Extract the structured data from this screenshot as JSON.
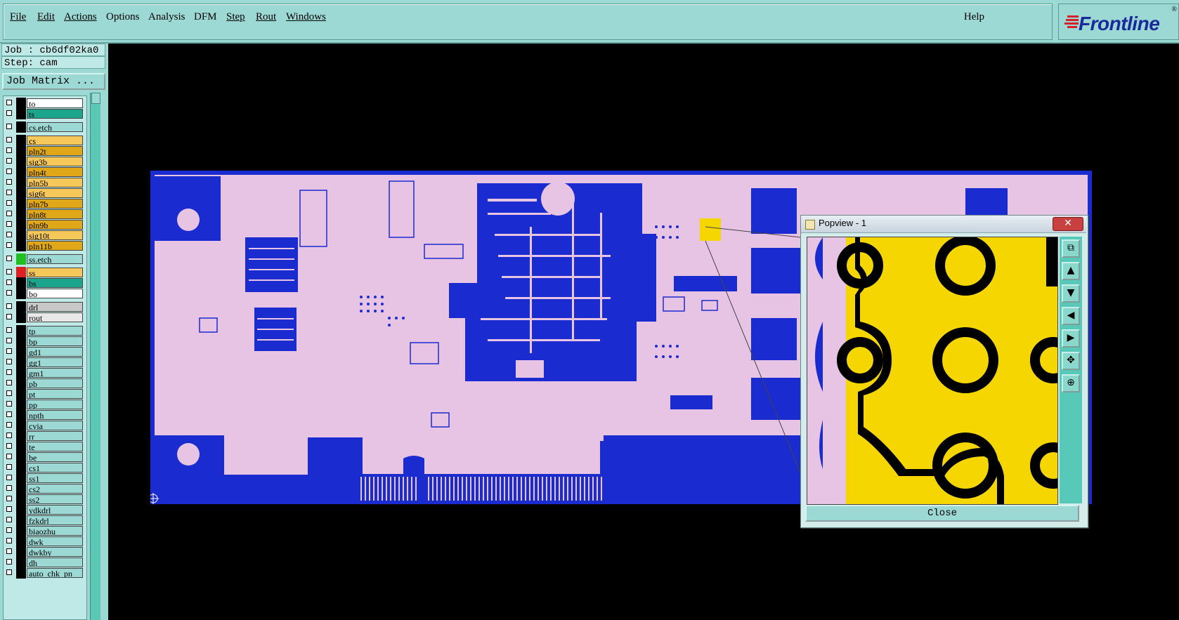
{
  "menu": {
    "items": [
      "File",
      "Edit",
      "Actions",
      "Options",
      "Analysis",
      "DFM",
      "Step",
      "Rout",
      "Windows"
    ],
    "help": "Help"
  },
  "logo": {
    "name": "Frontline",
    "mark": "®"
  },
  "job": {
    "job_line": "Job : cb6df02ka0",
    "step_line": "Step: cam",
    "matrix_button": "Job Matrix ..."
  },
  "layers": [
    {
      "name": "to",
      "color": "#ffffff"
    },
    {
      "name": "ts",
      "color": "#1aa58c"
    },
    {
      "name": "cs.etch",
      "color": "#9cd8d4"
    },
    {
      "name": "cs",
      "color": "#f6c85a"
    },
    {
      "name": "pln2t",
      "color": "#e0a818"
    },
    {
      "name": "sig3b",
      "color": "#f6c85a"
    },
    {
      "name": "pln4t",
      "color": "#e0a818"
    },
    {
      "name": "pln5b",
      "color": "#f6c85a"
    },
    {
      "name": "sig6t",
      "color": "#f6c85a"
    },
    {
      "name": "pln7b",
      "color": "#e0a818"
    },
    {
      "name": "pln8t",
      "color": "#e0a818"
    },
    {
      "name": "pln9b",
      "color": "#e0a818"
    },
    {
      "name": "sig10t",
      "color": "#f6c85a"
    },
    {
      "name": "pln11b",
      "color": "#e0a818"
    },
    {
      "name": "ss.etch",
      "color": "#9cd8d4"
    },
    {
      "name": "ss",
      "color": "#f6c85a"
    },
    {
      "name": "bs",
      "color": "#1aa58c"
    },
    {
      "name": "bo",
      "color": "#ffffff"
    },
    {
      "name": "drl",
      "color": "#c8c8c8"
    },
    {
      "name": "rout",
      "color": "#e8e8e8"
    },
    {
      "name": "tp",
      "color": "#9cd8d4"
    },
    {
      "name": "bp",
      "color": "#9cd8d4"
    },
    {
      "name": "gd1",
      "color": "#9cd8d4"
    },
    {
      "name": "gg1",
      "color": "#9cd8d4"
    },
    {
      "name": "gm1",
      "color": "#9cd8d4"
    },
    {
      "name": "pb",
      "color": "#9cd8d4"
    },
    {
      "name": "pt",
      "color": "#9cd8d4"
    },
    {
      "name": "pp",
      "color": "#9cd8d4"
    },
    {
      "name": "npth",
      "color": "#9cd8d4"
    },
    {
      "name": "cvia",
      "color": "#9cd8d4"
    },
    {
      "name": "rr",
      "color": "#9cd8d4"
    },
    {
      "name": "te",
      "color": "#9cd8d4"
    },
    {
      "name": "be",
      "color": "#9cd8d4"
    },
    {
      "name": "cs1",
      "color": "#9cd8d4"
    },
    {
      "name": "ss1",
      "color": "#9cd8d4"
    },
    {
      "name": "cs2",
      "color": "#9cd8d4"
    },
    {
      "name": "ss2",
      "color": "#9cd8d4"
    },
    {
      "name": "ydkdrl",
      "color": "#9cd8d4"
    },
    {
      "name": "fzkdrl",
      "color": "#9cd8d4"
    },
    {
      "name": "biaozhu",
      "color": "#9cd8d4"
    },
    {
      "name": "dwk",
      "color": "#9cd8d4"
    },
    {
      "name": "dwkby",
      "color": "#9cd8d4"
    },
    {
      "name": "dh",
      "color": "#9cd8d4"
    },
    {
      "name": "auto_chk_pn",
      "color": "#9cd8d4"
    }
  ],
  "popview": {
    "title": "Popview - 1",
    "close_label": "Close"
  },
  "colors": {
    "board_fill": "#e8c4e4",
    "copper": "#1a2bd0",
    "highlight": "#f6d600",
    "panel": "#9cd8d4"
  }
}
